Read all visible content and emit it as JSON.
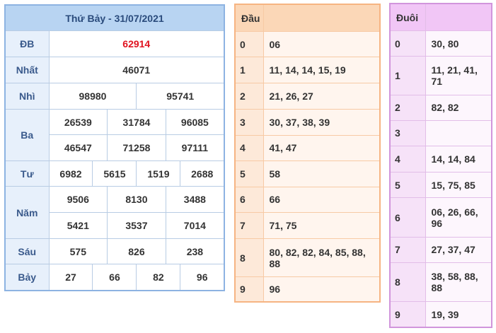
{
  "results": {
    "title": "Thứ Bảy - 31/07/2021",
    "db": {
      "label": "ĐB",
      "numbers": [
        "62914"
      ]
    },
    "nhat": {
      "label": "Nhất",
      "numbers": [
        "46071"
      ]
    },
    "nhi": {
      "label": "Nhì",
      "numbers": [
        "98980",
        "95741"
      ]
    },
    "ba": {
      "label": "Ba",
      "numbers": [
        "26539",
        "31784",
        "96085",
        "46547",
        "71258",
        "97111"
      ]
    },
    "tu": {
      "label": "Tư",
      "numbers": [
        "6982",
        "5615",
        "1519",
        "2688"
      ]
    },
    "nam": {
      "label": "Năm",
      "numbers": [
        "9506",
        "8130",
        "3488",
        "5421",
        "3537",
        "7014"
      ]
    },
    "sau": {
      "label": "Sáu",
      "numbers": [
        "575",
        "826",
        "238"
      ]
    },
    "bay": {
      "label": "Bảy",
      "numbers": [
        "27",
        "66",
        "82",
        "96"
      ]
    }
  },
  "dau": {
    "header": "Đầu",
    "rows": [
      {
        "key": "0",
        "value": "06"
      },
      {
        "key": "1",
        "value": "11, 14, 14, 15, 19"
      },
      {
        "key": "2",
        "value": "21, 26, 27"
      },
      {
        "key": "3",
        "value": "30, 37, 38, 39"
      },
      {
        "key": "4",
        "value": "41, 47"
      },
      {
        "key": "5",
        "value": "58"
      },
      {
        "key": "6",
        "value": "66"
      },
      {
        "key": "7",
        "value": "71, 75"
      },
      {
        "key": "8",
        "value": "80, 82, 82, 84, 85, 88, 88"
      },
      {
        "key": "9",
        "value": "96"
      }
    ]
  },
  "duoi": {
    "header": "Đuôi",
    "rows": [
      {
        "key": "0",
        "value": "30, 80"
      },
      {
        "key": "1",
        "value": "11, 21, 41, 71"
      },
      {
        "key": "2",
        "value": "82, 82"
      },
      {
        "key": "3",
        "value": ""
      },
      {
        "key": "4",
        "value": "14, 14, 84"
      },
      {
        "key": "5",
        "value": "15, 75, 85"
      },
      {
        "key": "6",
        "value": "06, 26, 66, 96"
      },
      {
        "key": "7",
        "value": "27, 37, 47"
      },
      {
        "key": "8",
        "value": "38, 58, 88, 88"
      },
      {
        "key": "9",
        "value": "19, 39"
      }
    ]
  },
  "colors": {
    "special_prize": "#e0121f",
    "results_header": "#b8d4f2",
    "dau_header": "#fbd7b7",
    "duoi_header": "#f1c6f6"
  }
}
